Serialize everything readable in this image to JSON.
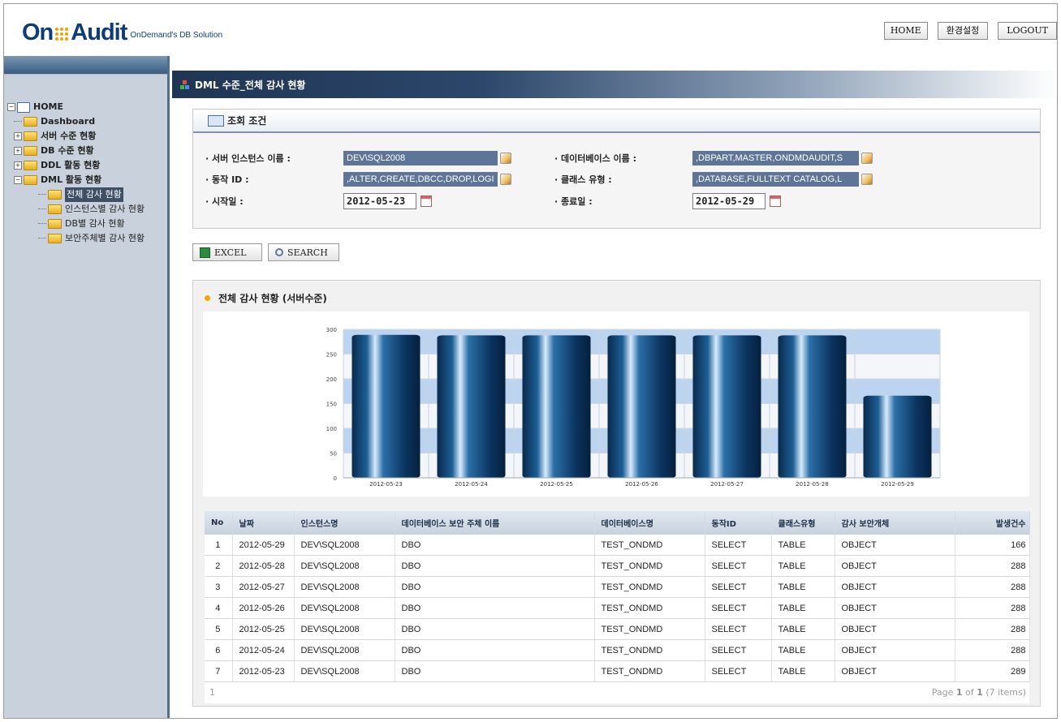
{
  "header": {
    "logo_on": "On",
    "logo_audit": "Audit",
    "logo_sub": "OnDemand's DB Solution",
    "home_btn": "HOME",
    "settings_btn": "환경설정",
    "logout_btn": "LOGOUT"
  },
  "sidebar": {
    "root": "HOME",
    "items": [
      {
        "label": "Dashboard"
      },
      {
        "label": "서버 수준 현황"
      },
      {
        "label": "DB 수준 현황"
      },
      {
        "label": "DDL 활동 현황"
      },
      {
        "label": "DML 활동 현황"
      }
    ],
    "dml_children": [
      {
        "label": "전체 감사 현황"
      },
      {
        "label": "인스턴스별 감사 현황"
      },
      {
        "label": "DB별 감사 현황"
      },
      {
        "label": "보안주체별 감사 현황"
      }
    ]
  },
  "page": {
    "title": "DML 수준_전체 감사 현황"
  },
  "conditions": {
    "title": "조회 조건",
    "server_label": "· 서버 인스턴스 이름 :",
    "server_value": "DEV\\SQL2008",
    "db_label": "· 데이터베이스 이름 :",
    "db_value": ",DBPART,MASTER,ONDMDAUDIT,S",
    "action_label": "· 동작 ID :",
    "action_value": ",ALTER,CREATE,DBCC,DROP,LOGI",
    "class_label": "· 클래스 유형 :",
    "class_value": ",DATABASE,FULLTEXT CATALOG,L",
    "start_label": "· 시작일 :",
    "start_value": "2012-05-23",
    "end_label": "· 종료일 :",
    "end_value": "2012-05-29"
  },
  "actions": {
    "excel": "EXCEL",
    "search": "SEARCH"
  },
  "panel": {
    "title": "전체 감사 현황 (서버수준)"
  },
  "chart_data": {
    "type": "bar",
    "categories": [
      "2012-05-23",
      "2012-05-24",
      "2012-05-25",
      "2012-05-26",
      "2012-05-27",
      "2012-05-28",
      "2012-05-29"
    ],
    "values": [
      289,
      288,
      288,
      288,
      288,
      288,
      166
    ],
    "ylim": [
      0,
      300
    ],
    "yticks": [
      0,
      50,
      100,
      150,
      200,
      250,
      300
    ],
    "grid": true,
    "bar_color": "#0e3a66",
    "band_color": "#bcd4ef"
  },
  "table": {
    "headers": [
      "No",
      "날짜",
      "인스턴스명",
      "데이터베이스 보안 주체 이름",
      "데이터베이스명",
      "동작ID",
      "클래스유형",
      "감사 보안개체",
      "발생건수"
    ],
    "rows": [
      [
        "1",
        "2012-05-29",
        "DEV\\SQL2008",
        "DBO",
        "TEST_ONDMD",
        "SELECT",
        "TABLE",
        "OBJECT",
        "166"
      ],
      [
        "2",
        "2012-05-28",
        "DEV\\SQL2008",
        "DBO",
        "TEST_ONDMD",
        "SELECT",
        "TABLE",
        "OBJECT",
        "288"
      ],
      [
        "3",
        "2012-05-27",
        "DEV\\SQL2008",
        "DBO",
        "TEST_ONDMD",
        "SELECT",
        "TABLE",
        "OBJECT",
        "288"
      ],
      [
        "4",
        "2012-05-26",
        "DEV\\SQL2008",
        "DBO",
        "TEST_ONDMD",
        "SELECT",
        "TABLE",
        "OBJECT",
        "288"
      ],
      [
        "5",
        "2012-05-25",
        "DEV\\SQL2008",
        "DBO",
        "TEST_ONDMD",
        "SELECT",
        "TABLE",
        "OBJECT",
        "288"
      ],
      [
        "6",
        "2012-05-24",
        "DEV\\SQL2008",
        "DBO",
        "TEST_ONDMD",
        "SELECT",
        "TABLE",
        "OBJECT",
        "288"
      ],
      [
        "7",
        "2012-05-23",
        "DEV\\SQL2008",
        "DBO",
        "TEST_ONDMD",
        "SELECT",
        "TABLE",
        "OBJECT",
        "289"
      ]
    ],
    "footer_left": "1",
    "pager_prefix": "Page ",
    "pager_current": "1",
    "pager_of": " of ",
    "pager_total": "1",
    "pager_items": " (7 items)"
  }
}
